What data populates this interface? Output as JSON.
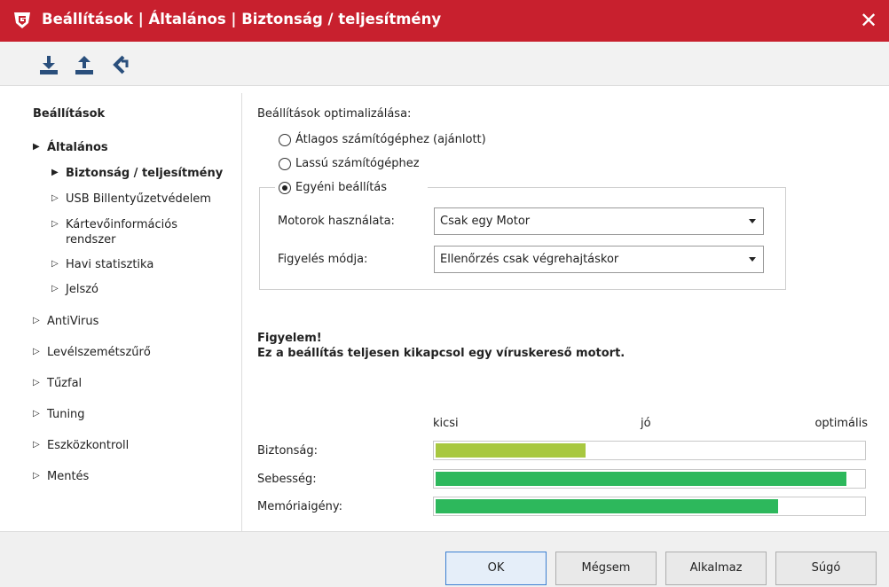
{
  "window": {
    "title": "Beállítások | Általános | Biztonság / teljesítmény",
    "close_label": "✕",
    "accent_color": "#c8202e"
  },
  "toolbar": {
    "icons": [
      "download-icon",
      "upload-icon",
      "reset-icon"
    ]
  },
  "sidebar": {
    "heading": "Beállítások",
    "items": [
      {
        "label": "Általános",
        "arrow": "▶",
        "expanded": true
      },
      {
        "label": "Biztonság / teljesítmény",
        "arrow": "▶",
        "selected": true
      },
      {
        "label": "USB Billentyűzetvédelem",
        "arrow": "▷"
      },
      {
        "label": "Kártevőinformációs",
        "label_line2": "rendszer",
        "arrow": "▷"
      },
      {
        "label": "Havi statisztika",
        "arrow": "▷"
      },
      {
        "label": "Jelszó",
        "arrow": "▷"
      },
      {
        "label": "AntiVirus",
        "arrow": "▷"
      },
      {
        "label": "Levélszemétszűrő",
        "arrow": "▷"
      },
      {
        "label": "Tűzfal",
        "arrow": "▷"
      },
      {
        "label": "Tuning",
        "arrow": "▷"
      },
      {
        "label": "Eszközkontroll",
        "arrow": "▷"
      },
      {
        "label": "Mentés",
        "arrow": "▷"
      }
    ]
  },
  "main": {
    "section_label": "Beállítások optimalizálása:",
    "options": [
      {
        "label": "Átlagos számítógéphez (ajánlott)",
        "checked": false
      },
      {
        "label": "Lassú számítógéphez",
        "checked": false
      },
      {
        "label": "Egyéni beállítás",
        "checked": true
      }
    ],
    "engines_label": "Motorok használata:",
    "engines_value": "Csak egy Motor",
    "monitor_label": "Figyelés módja:",
    "monitor_value": "Ellenőrzés csak végrehajtáskor",
    "warning_title": "Figyelem!",
    "warning_text": "Ez a beállítás teljesen kikapcsol egy víruskereső motort.",
    "scale": {
      "low": "kicsi",
      "mid": "jó",
      "high": "optimális"
    },
    "meters": [
      {
        "label": "Biztonság:",
        "level": 0.35,
        "color": "#a8c840"
      },
      {
        "label": "Sebesség:",
        "level": 0.96,
        "color": "#2db85c"
      },
      {
        "label": "Memóriaigény:",
        "level": 0.8,
        "color": "#2db85c"
      }
    ]
  },
  "footer": {
    "ok": "OK",
    "cancel": "Mégsem",
    "apply": "Alkalmaz",
    "help": "Súgó"
  }
}
